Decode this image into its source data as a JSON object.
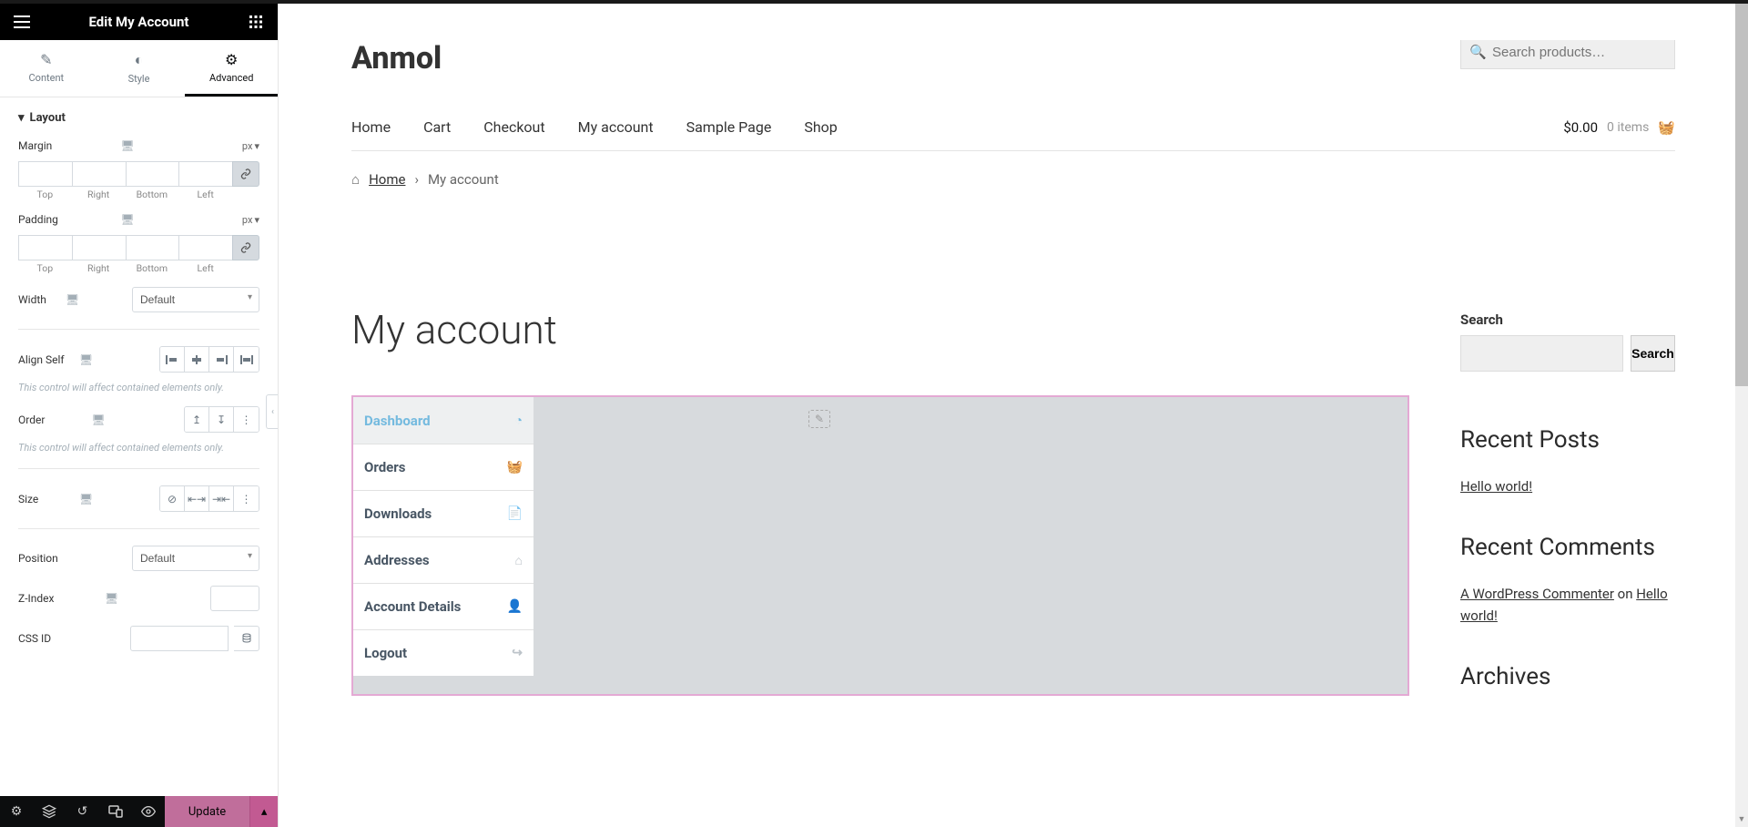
{
  "header": {
    "title": "Edit My Account"
  },
  "tabs": {
    "content": "Content",
    "style": "Style",
    "advanced": "Advanced"
  },
  "sections": {
    "layout": "Layout"
  },
  "controls": {
    "margin": {
      "label": "Margin",
      "unit": "px",
      "parts": [
        "Top",
        "Right",
        "Bottom",
        "Left"
      ]
    },
    "padding": {
      "label": "Padding",
      "unit": "px",
      "parts": [
        "Top",
        "Right",
        "Bottom",
        "Left"
      ]
    },
    "width": {
      "label": "Width",
      "value": "Default"
    },
    "align_self": {
      "label": "Align Self"
    },
    "align_note": "This control will affect contained elements only.",
    "order": {
      "label": "Order"
    },
    "order_note": "This control will affect contained elements only.",
    "size": {
      "label": "Size"
    },
    "position": {
      "label": "Position",
      "value": "Default"
    },
    "zindex": {
      "label": "Z-Index",
      "value": ""
    },
    "cssid": {
      "label": "CSS ID",
      "value": ""
    }
  },
  "footer": {
    "update": "Update"
  },
  "preview": {
    "site_title": "Anmol",
    "search_placeholder": "Search products…",
    "nav": [
      "Home",
      "Cart",
      "Checkout",
      "My account",
      "Sample Page",
      "Shop"
    ],
    "cart": {
      "price": "$0.00",
      "items": "0 items"
    },
    "breadcrumb": {
      "home": "Home",
      "current": "My account"
    },
    "page_title": "My account",
    "account_nav": [
      {
        "label": "Dashboard",
        "active": true,
        "icon": "gauge"
      },
      {
        "label": "Orders",
        "icon": "basket"
      },
      {
        "label": "Downloads",
        "icon": "file"
      },
      {
        "label": "Addresses",
        "icon": "home"
      },
      {
        "label": "Account Details",
        "icon": "user"
      },
      {
        "label": "Logout",
        "icon": "signout"
      }
    ],
    "sidebar": {
      "search_label": "Search",
      "search_btn": "Search",
      "recent_posts": {
        "title": "Recent Posts",
        "link": "Hello world!"
      },
      "recent_comments": {
        "title": "Recent Comments",
        "author": "A WordPress Commenter",
        "on": " on ",
        "post": "Hello world!"
      },
      "archives_title": "Archives"
    }
  }
}
